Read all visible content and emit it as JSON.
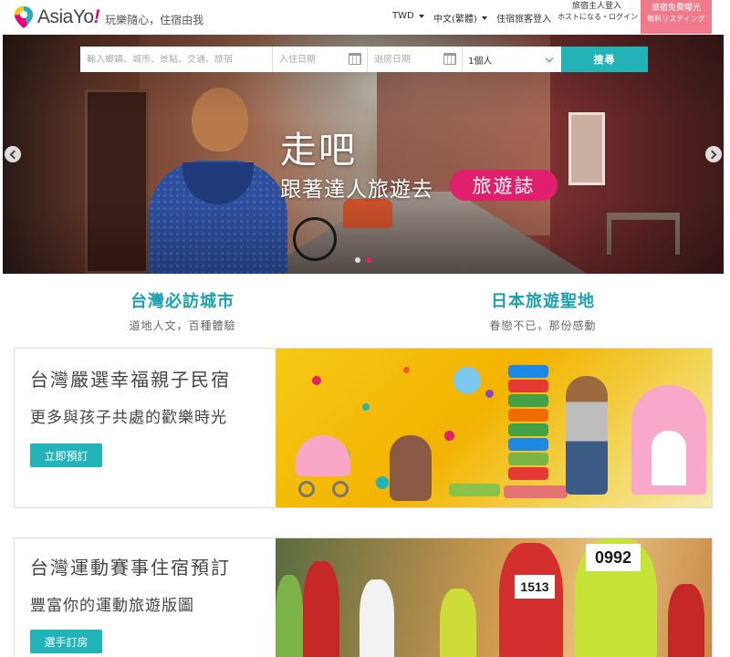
{
  "header": {
    "logo_text": "AsiaYo",
    "logo_excl": "!",
    "slogan": "玩樂隨心，住宿由我",
    "currency": "TWD",
    "language": "中文(繁體)",
    "guest_login": "住宿旅客登入",
    "host_login": "旅宿主人登入",
    "host_login_jp": "ホストになる・ログイン",
    "free_listing": "旅宿免費曝光",
    "free_listing_jp": "無料リスティング"
  },
  "search": {
    "destination_placeholder": "輸入鄉鎮、城市、景點、交通、旅宿",
    "checkin_placeholder": "入住日期",
    "checkout_placeholder": "退房日期",
    "guests_value": "1個人",
    "button_label": "搜尋"
  },
  "hero": {
    "title": "走吧",
    "subtitle": "跟著達人旅遊去",
    "tag": "旅遊誌",
    "slide_count": 2,
    "active_slide": 2
  },
  "promos": [
    {
      "title": "台灣必訪城市",
      "subtitle": "道地人文，百種體驗"
    },
    {
      "title": "日本旅遊聖地",
      "subtitle": "眷戀不已，那份感動"
    }
  ],
  "cards": [
    {
      "title": "台灣嚴選幸福親子民宿",
      "desc": "更多與孩子共處的歡樂時光",
      "button": "立即預訂"
    },
    {
      "title": "台灣運動賽事住宿預訂",
      "desc": "豐富你的運動旅遊版圖",
      "button": "選手訂房"
    }
  ],
  "runner_bibs": [
    "1513",
    "0992"
  ],
  "colors": {
    "accent_teal": "#22b3b8",
    "title_teal": "#1aa1ad",
    "hero_tag_pink": "#e0206d",
    "free_listing_bg": "#f07a8c"
  }
}
